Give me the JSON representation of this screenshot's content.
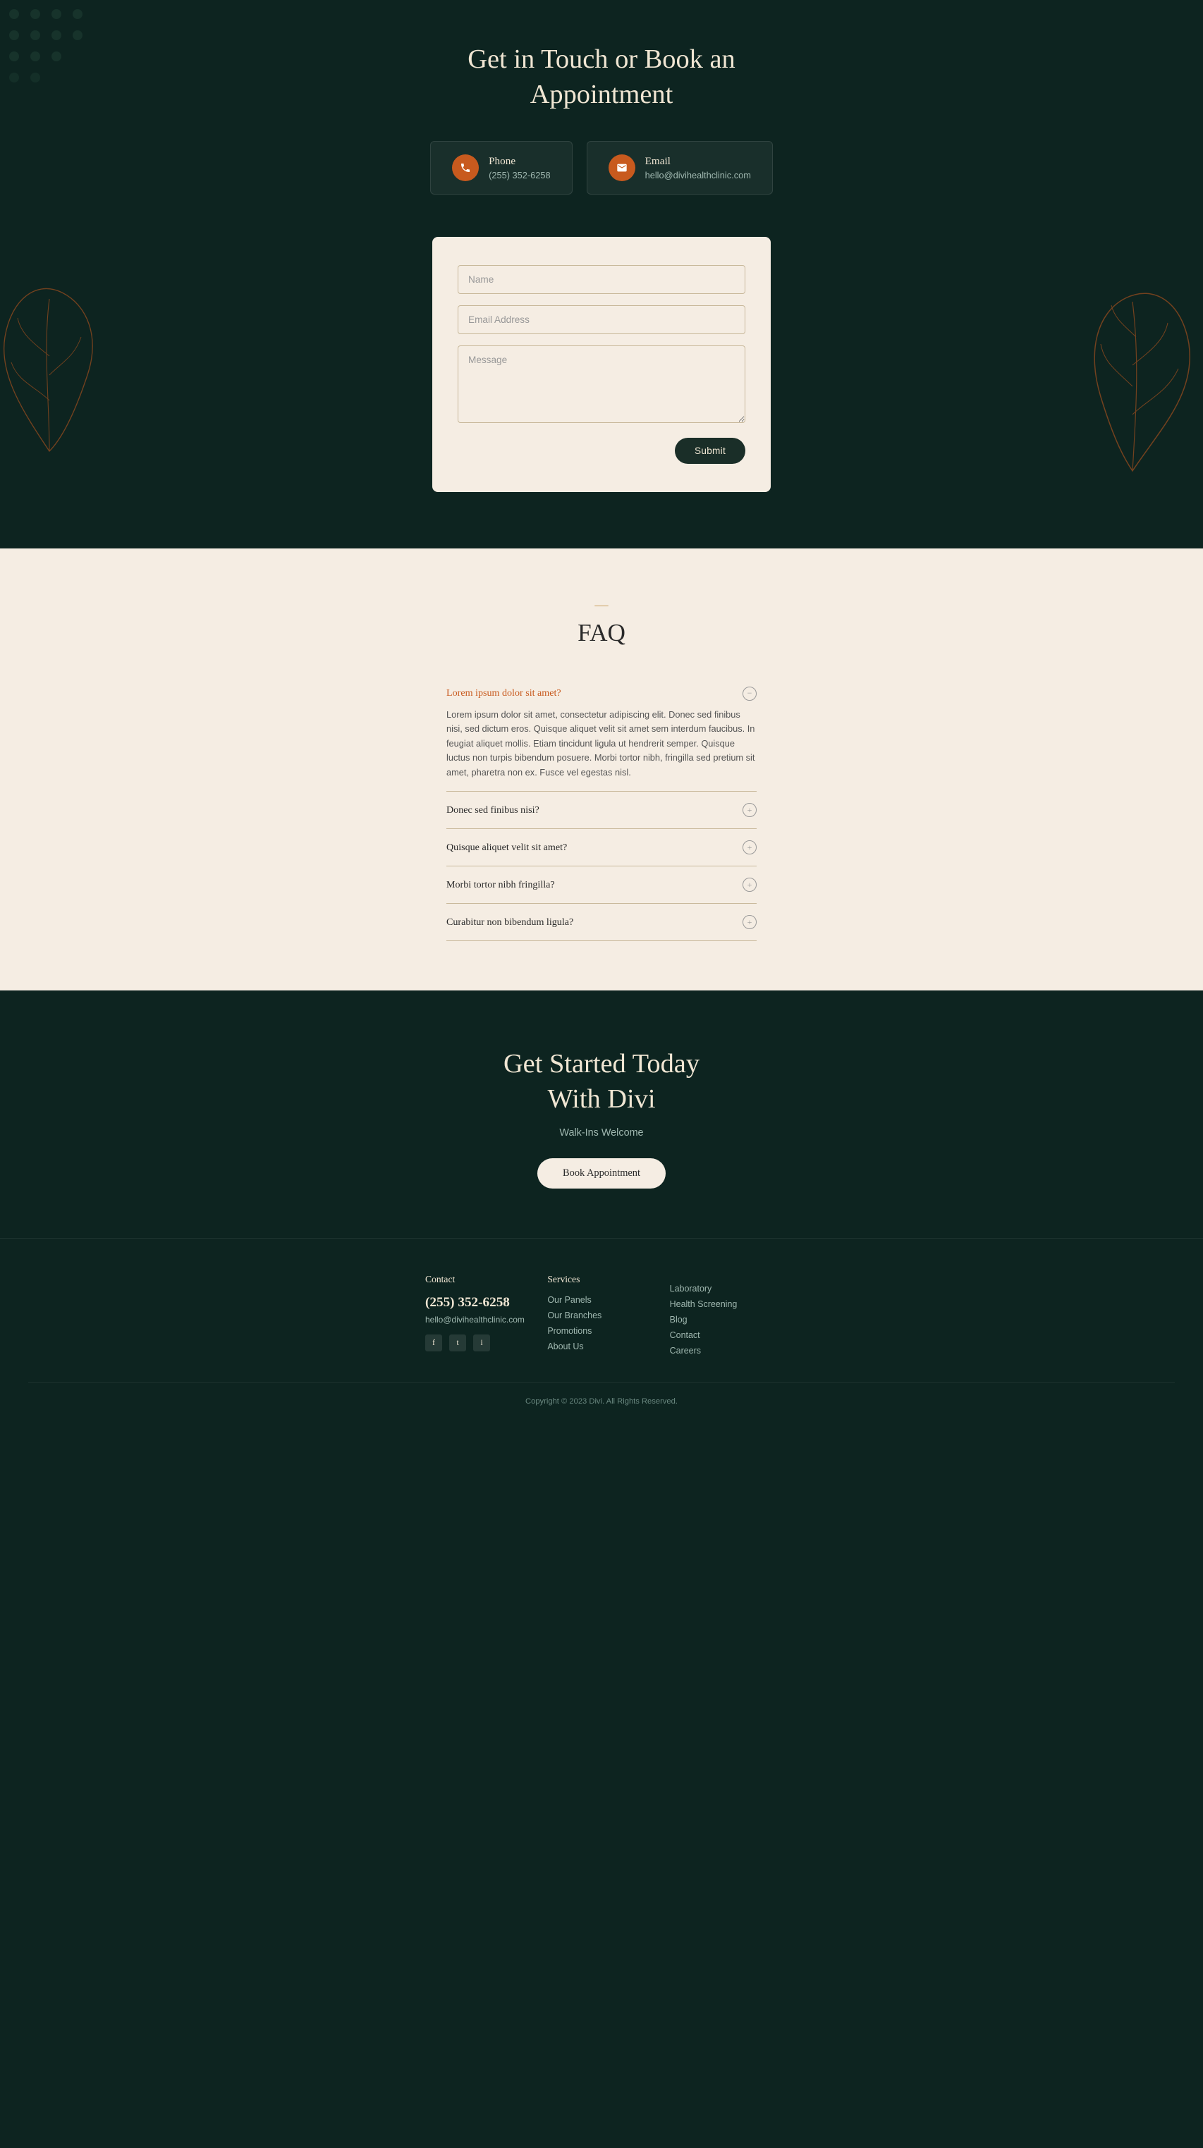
{
  "hero": {
    "title": "Get in Touch or Book an Appointment",
    "phone_label": "Phone",
    "phone_value": "(255) 352-6258",
    "email_label": "Email",
    "email_value": "hello@divihealthclinic.com"
  },
  "form": {
    "name_placeholder": "Name",
    "email_placeholder": "Email Address",
    "message_placeholder": "Message",
    "submit_label": "Submit"
  },
  "faq": {
    "section_label": "—",
    "title": "FAQ",
    "items": [
      {
        "question": "Lorem ipsum dolor sit amet?",
        "answer": "Lorem ipsum dolor sit amet, consectetur adipiscing elit. Donec sed finibus nisi, sed dictum eros. Quisque aliquet velit sit amet sem interdum faucibus. In feugiat aliquet mollis. Etiam tincidunt ligula ut hendrerit semper. Quisque luctus non turpis bibendum posuere. Morbi tortor nibh, fringilla sed pretium sit amet, pharetra non ex. Fusce vel egestas nisl.",
        "open": true
      },
      {
        "question": "Donec sed finibus nisi?",
        "answer": "",
        "open": false
      },
      {
        "question": "Quisque aliquet velit sit amet?",
        "answer": "",
        "open": false
      },
      {
        "question": "Morbi tortor nibh fringilla?",
        "answer": "",
        "open": false
      },
      {
        "question": "Curabitur non bibendum ligula?",
        "answer": "",
        "open": false
      }
    ]
  },
  "cta": {
    "title": "Get Started Today With Divi",
    "subtitle": "Walk-Ins Welcome",
    "button_label": "Book Appointment"
  },
  "footer": {
    "contact_label": "Contact",
    "phone": "(255) 352-6258",
    "email": "hello@divihealthclinic.com",
    "services_label": "Services",
    "services_links": [
      "Our Panels",
      "Our Branches",
      "Promotions",
      "About Us"
    ],
    "more_label": "",
    "more_links": [
      "Laboratory",
      "Health Screening",
      "Blog",
      "Contact",
      "Careers"
    ],
    "social": [
      "f",
      "t",
      "i"
    ],
    "copyright": "Copyright © 2023 Divi. All Rights Reserved."
  }
}
